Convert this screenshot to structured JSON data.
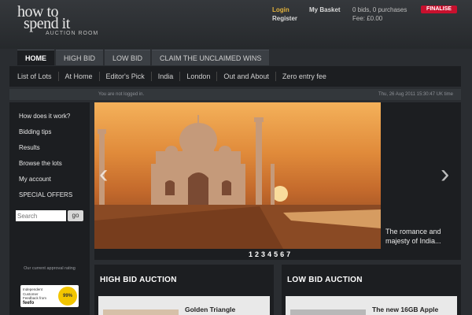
{
  "logo": {
    "line1": "how to",
    "line2": "spend it",
    "sub": "AUCTION ROOM"
  },
  "account": {
    "login": "Login",
    "register": "Register",
    "basket_label": "My Basket",
    "basket_status": "0 bids, 0 purchases",
    "fee": "Fee: £0.00",
    "finalise": "FINALISE"
  },
  "tabs": [
    "HOME",
    "HIGH BID",
    "LOW BID",
    "CLAIM THE UNCLAIMED WINS"
  ],
  "subnav": [
    "List of Lots",
    "At Home",
    "Editor's Pick",
    "India",
    "London",
    "Out and About",
    "Zero entry fee"
  ],
  "info": {
    "left": "You are not logged in.",
    "right": "Thu, 26 Aug 2011 15:30:47 UK time"
  },
  "sidebar": {
    "items": [
      "How does it work?",
      "Bidding tips",
      "Results",
      "Browse the lots",
      "My account",
      "SPECIAL OFFERS"
    ],
    "search_placeholder": "Search",
    "search_go": "go",
    "rating_label": "Our current approval rating",
    "feefo_text": "Independent Customer Feedback from",
    "feefo_brand": "feefo",
    "feefo_score": "99%"
  },
  "slider": {
    "caption": "The romance and majesty of India...",
    "pages": [
      "1",
      "2",
      "3",
      "4",
      "5",
      "6",
      "7"
    ],
    "active_page": 1
  },
  "panels": {
    "high": {
      "title": "HIGH BID AUCTION",
      "item": "Golden Triangle"
    },
    "low": {
      "title": "LOW BID AUCTION",
      "item": "The new 16GB Apple"
    }
  },
  "colors": {
    "accent": "#e2b23c",
    "finalise": "#c8102e",
    "panel_bg": "#1c1e21",
    "page_bg": "#2a2d31"
  }
}
